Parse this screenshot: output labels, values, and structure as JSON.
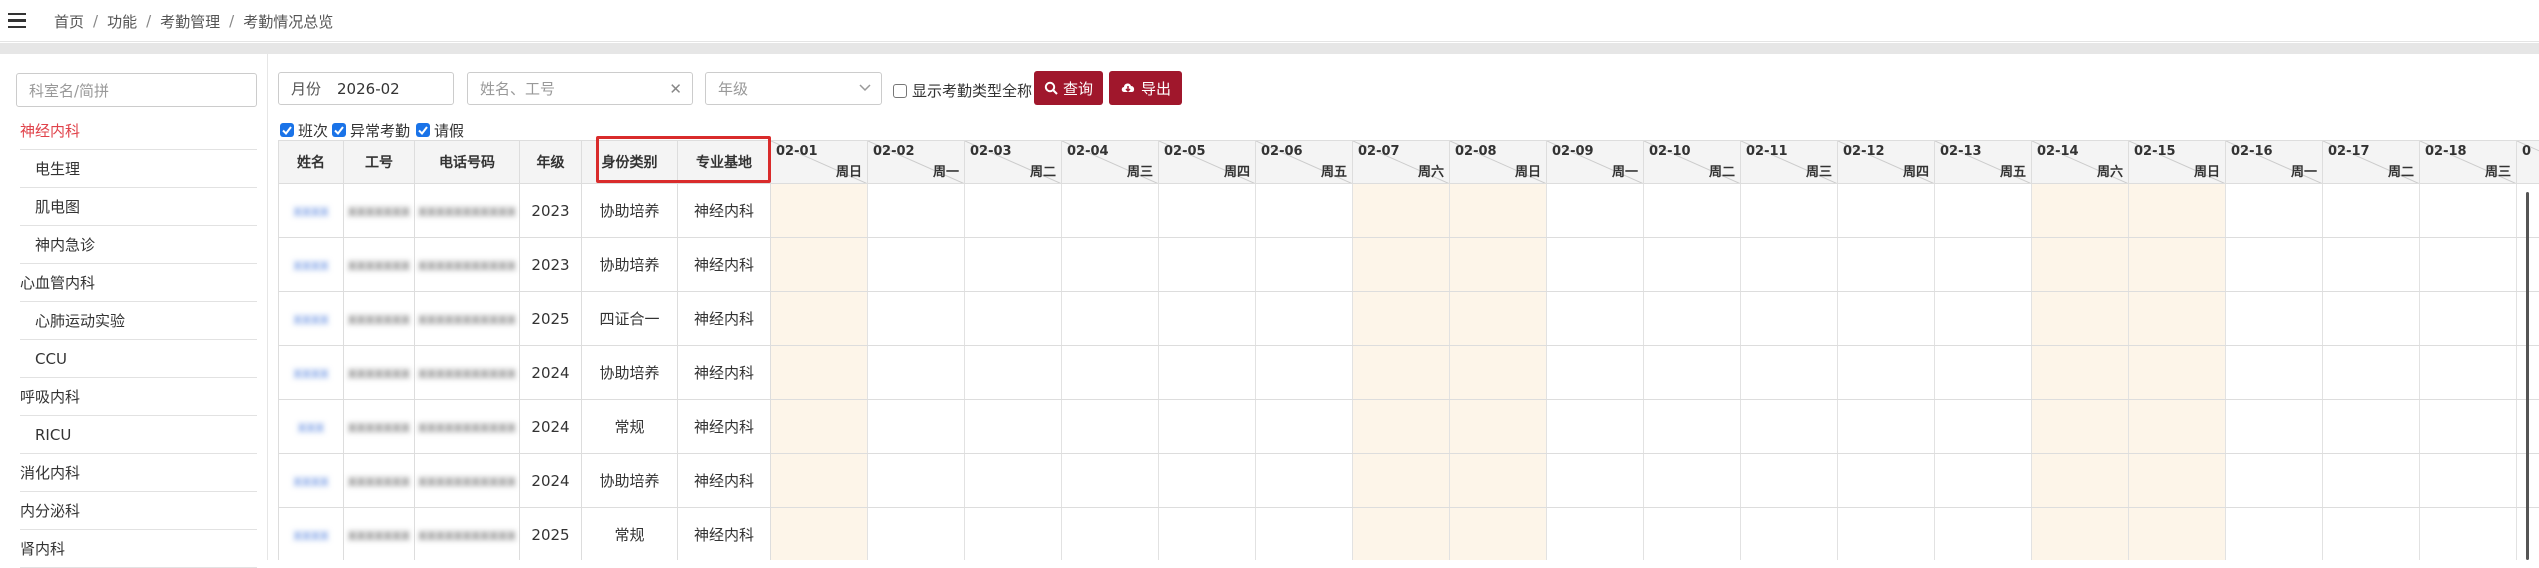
{
  "breadcrumb": [
    "首页",
    "功能",
    "考勤管理",
    "考勤情况总览"
  ],
  "sidebar": {
    "search_placeholder": "科室名/简拼",
    "items": [
      {
        "label": "神经内科",
        "level": 0,
        "active": true
      },
      {
        "label": "电生理",
        "level": 1
      },
      {
        "label": "肌电图",
        "level": 1
      },
      {
        "label": "神内急诊",
        "level": 1
      },
      {
        "label": "心血管内科",
        "level": 0
      },
      {
        "label": "心肺运动实验",
        "level": 1
      },
      {
        "label": "CCU",
        "level": 1
      },
      {
        "label": "呼吸内科",
        "level": 0
      },
      {
        "label": "RICU",
        "level": 1
      },
      {
        "label": "消化内科",
        "level": 0
      },
      {
        "label": "内分泌科",
        "level": 0
      },
      {
        "label": "肾内科",
        "level": 0
      }
    ]
  },
  "toolbar": {
    "month_label": "月份",
    "month_value": "2026-02",
    "name_placeholder": "姓名、工号",
    "grade_placeholder": "年级",
    "show_fullname_label": "显示考勤类型全称",
    "query_label": "查询",
    "export_label": "导出",
    "accent": "#a0172c"
  },
  "filters": [
    {
      "label": "班次",
      "checked": true
    },
    {
      "label": "异常考勤",
      "checked": true
    },
    {
      "label": "请假",
      "checked": true
    }
  ],
  "table": {
    "headers": [
      "姓名",
      "工号",
      "电话号码",
      "年级",
      "身份类别",
      "专业基地"
    ],
    "highlight_color": "#d92b2b",
    "weekend_color": "#fdf5e9",
    "days": [
      {
        "date": "02-01",
        "weekday": "周日",
        "weekend": true
      },
      {
        "date": "02-02",
        "weekday": "周一"
      },
      {
        "date": "02-03",
        "weekday": "周二"
      },
      {
        "date": "02-04",
        "weekday": "周三"
      },
      {
        "date": "02-05",
        "weekday": "周四"
      },
      {
        "date": "02-06",
        "weekday": "周五"
      },
      {
        "date": "02-07",
        "weekday": "周六",
        "weekend": true
      },
      {
        "date": "02-08",
        "weekday": "周日",
        "weekend": true
      },
      {
        "date": "02-09",
        "weekday": "周一"
      },
      {
        "date": "02-10",
        "weekday": "周二"
      },
      {
        "date": "02-11",
        "weekday": "周三"
      },
      {
        "date": "02-12",
        "weekday": "周四"
      },
      {
        "date": "02-13",
        "weekday": "周五"
      },
      {
        "date": "02-14",
        "weekday": "周六",
        "weekend": true
      },
      {
        "date": "02-15",
        "weekday": "周日",
        "weekend": true
      },
      {
        "date": "02-16",
        "weekday": "周一"
      },
      {
        "date": "02-17",
        "weekday": "周二"
      },
      {
        "date": "02-18",
        "weekday": "周三"
      },
      {
        "date": "0",
        "weekday": ""
      }
    ],
    "rows": [
      {
        "name": "xxxx",
        "id": "xxxxxxx",
        "phone": "xxxxxxxxxxx",
        "grade": "2023",
        "identity": "协助培养",
        "base": "神经内科"
      },
      {
        "name": "xxxx",
        "id": "xxxxxxx",
        "phone": "xxxxxxxxxxx",
        "grade": "2023",
        "identity": "协助培养",
        "base": "神经内科"
      },
      {
        "name": "xxxx",
        "id": "xxxxxxx",
        "phone": "xxxxxxxxxxx",
        "grade": "2025",
        "identity": "四证合一",
        "base": "神经内科"
      },
      {
        "name": "xxxx",
        "id": "xxxxxxx",
        "phone": "xxxxxxxxxxx",
        "grade": "2024",
        "identity": "协助培养",
        "base": "神经内科"
      },
      {
        "name": "xxx",
        "id": "xxxxxxx",
        "phone": "xxxxxxxxxxx",
        "grade": "2024",
        "identity": "常规",
        "base": "神经内科"
      },
      {
        "name": "xxxx",
        "id": "xxxxxxx",
        "phone": "xxxxxxxxxxx",
        "grade": "2024",
        "identity": "协助培养",
        "base": "神经内科"
      },
      {
        "name": "xxxx",
        "id": "xxxxxxx",
        "phone": "xxxxxxxxxxx",
        "grade": "2025",
        "identity": "常规",
        "base": "神经内科"
      }
    ]
  }
}
